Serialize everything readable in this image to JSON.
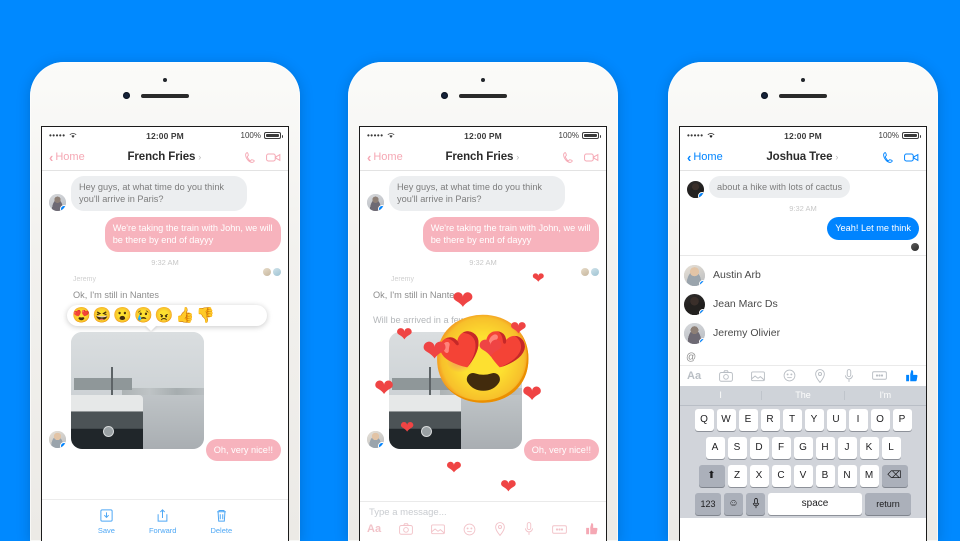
{
  "background_color": "#0089ff",
  "status_bar": {
    "signal": "•••••",
    "wifi": "⌃",
    "time": "12:00 PM",
    "battery": "100%"
  },
  "phone1": {
    "theme": "pink",
    "nav": {
      "back": "Home",
      "title": "French Fries",
      "chevron": "›",
      "call_icon": "phone-icon",
      "video_icon": "video-icon"
    },
    "messages": [
      {
        "dir": "in",
        "text": "Hey guys, at what time do you think you'll arrive in Paris?"
      },
      {
        "dir": "out",
        "text": "We're taking the train with John, we will be there by end of dayyy"
      }
    ],
    "timestamp": "9:32 AM",
    "sender_name": "Jeremy",
    "reacted_message": "Ok, I'm still in Nantes",
    "reactions": [
      "😍",
      "😆",
      "😮",
      "😢",
      "😠",
      "👍",
      "👎"
    ],
    "photo_reply": "Oh, very nice!!",
    "actions": [
      {
        "label": "Save",
        "icon": "save-icon"
      },
      {
        "label": "Forward",
        "icon": "forward-icon"
      },
      {
        "label": "Delete",
        "icon": "trash-icon"
      }
    ]
  },
  "phone2": {
    "theme": "pink",
    "nav": {
      "back": "Home",
      "title": "French Fries",
      "chevron": "›"
    },
    "messages": [
      {
        "dir": "in",
        "text": "Hey guys, at what time do you think you'll arrive in Paris?"
      },
      {
        "dir": "out",
        "text": "We're taking the train with John, we will be there by end of dayyy"
      }
    ],
    "timestamp": "9:32 AM",
    "sender_name": "Jeremy",
    "message3": "Ok, I'm still in Nantes",
    "message4": "Will be arrived in a few",
    "photo_reply": "Oh, very nice!!",
    "big_emoji": "😍",
    "hearts_count": 11,
    "composer_placeholder": "Type a message...",
    "toolbar_icons": [
      "text-format-icon",
      "camera-icon",
      "gallery-icon",
      "emoji-icon",
      "location-icon",
      "mic-icon",
      "sticker-icon",
      "thumbs-up-icon"
    ]
  },
  "phone3": {
    "theme": "blue",
    "nav": {
      "back": "Home",
      "title": "Joshua Tree",
      "chevron": "›"
    },
    "messages": [
      {
        "dir": "in",
        "text": "about a hike with lots of cactus"
      },
      {
        "dir": "out",
        "text": "Yeah! Let me think"
      }
    ],
    "timestamp": "9:32 AM",
    "mention_trigger": "@",
    "members": [
      {
        "name": "Austin Arb"
      },
      {
        "name": "Jean Marc Ds"
      },
      {
        "name": "Jeremy Olivier"
      }
    ],
    "toolbar_icons": [
      "text-format-icon",
      "camera-icon",
      "gallery-icon",
      "emoji-icon",
      "location-icon",
      "mic-icon",
      "sticker-icon",
      "thumbs-up-icon"
    ],
    "keyboard": {
      "predictions": [
        "I",
        "The",
        "I'm"
      ],
      "row1": [
        "Q",
        "W",
        "E",
        "R",
        "T",
        "Y",
        "U",
        "I",
        "O",
        "P"
      ],
      "row2": [
        "A",
        "S",
        "D",
        "F",
        "G",
        "H",
        "J",
        "K",
        "L"
      ],
      "row3": [
        "Z",
        "X",
        "C",
        "V",
        "B",
        "N",
        "M"
      ],
      "shift": "⬆",
      "backspace": "⌫",
      "numbers": "123",
      "emoji_key": "☺",
      "mic_key": "🎤",
      "space": "space",
      "return": "return"
    }
  },
  "accent_pink": "#f5a8b4",
  "accent_blue": "#0084ff"
}
